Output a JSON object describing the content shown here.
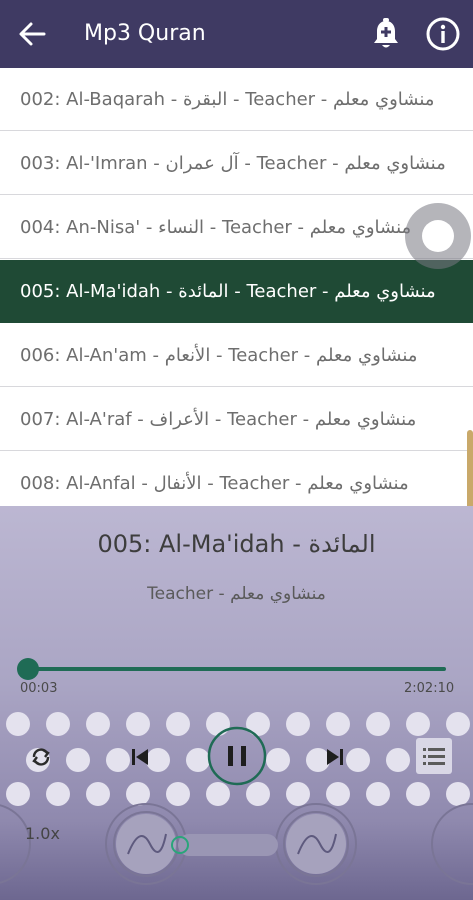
{
  "header": {
    "title": "Mp3 Quran",
    "bg_color": "#3f3a63"
  },
  "tracks": [
    {
      "label": "002: Al-Baqarah - البقرة - Teacher - منشاوي معلم",
      "active": false
    },
    {
      "label": "003: Al-'Imran - آل عمران - Teacher - منشاوي معلم",
      "active": false
    },
    {
      "label": "004: An-Nisa' - النساء - Teacher - منشاوي معلم",
      "active": false
    },
    {
      "label": "005: Al-Ma'idah - المائدة - Teacher - منشاوي معلم",
      "active": true
    },
    {
      "label": "006: Al-An'am - الأنعام - Teacher - منشاوي معلم",
      "active": false
    },
    {
      "label": "007: Al-A'raf - الأعراف - Teacher - منشاوي معلم",
      "active": false
    },
    {
      "label": "008: Al-Anfal - الأنفال - Teacher - منشاوي معلم",
      "active": false
    }
  ],
  "player": {
    "now_playing_title": "005: Al-Ma'idah - المائدة",
    "now_playing_subtitle": "Teacher - منشاوي معلم",
    "current_time": "00:03",
    "total_time": "2:02:10",
    "progress_fraction": 0.0004,
    "speed": "1.0x",
    "accent_color": "#1f6b55",
    "active_row_color": "#1f4a35"
  },
  "icons": {
    "back": "arrow-left-icon",
    "bell": "bell-plus-icon",
    "info": "info-icon",
    "repeat": "repeat-icon",
    "previous": "skip-previous-icon",
    "pause": "pause-icon",
    "next": "skip-next-icon",
    "playlist": "playlist-icon"
  }
}
